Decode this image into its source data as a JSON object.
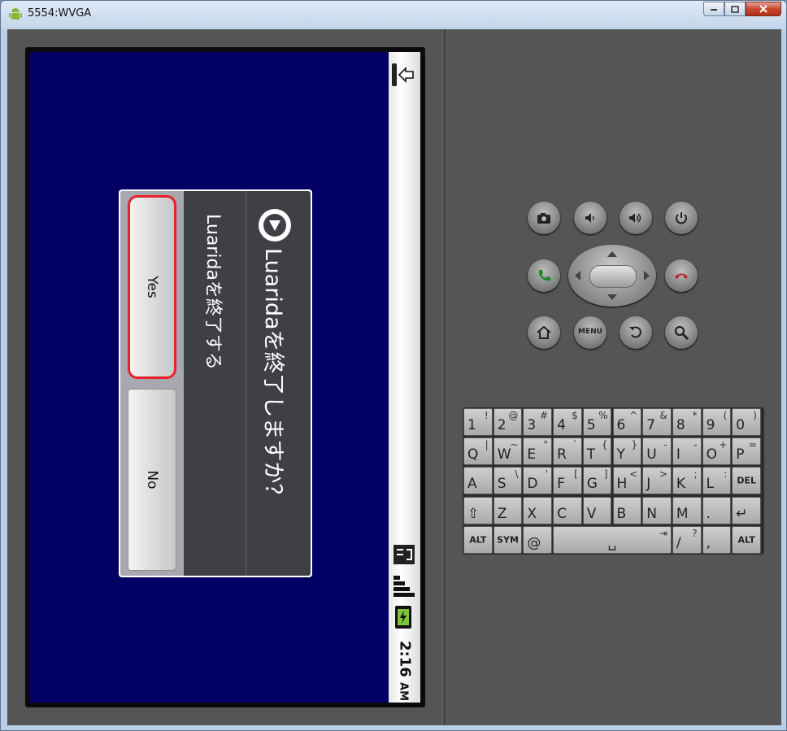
{
  "window": {
    "title": "5554:WVGA"
  },
  "status_bar": {
    "network": "3G",
    "time": "2:16",
    "ampm": "AM"
  },
  "dialog": {
    "title": "Luaridaを終了しますか？",
    "message": "Luaridaを終了する",
    "yes_label": "Yes",
    "no_label": "No"
  },
  "hardware_keys": {
    "menu_label": "MENU"
  },
  "keyboard": {
    "rows": [
      [
        [
          "1",
          "!"
        ],
        [
          "2",
          "@"
        ],
        [
          "3",
          "#"
        ],
        [
          "4",
          "$"
        ],
        [
          "5",
          "%"
        ],
        [
          "6",
          "^"
        ],
        [
          "7",
          "&"
        ],
        [
          "8",
          "*"
        ],
        [
          "9",
          "("
        ],
        [
          "0",
          ")"
        ]
      ],
      [
        [
          "Q",
          "|"
        ],
        [
          "W",
          "~"
        ],
        [
          "E",
          "\""
        ],
        [
          "R",
          "`"
        ],
        [
          "T",
          "{"
        ],
        [
          "Y",
          "}"
        ],
        [
          "U",
          "-"
        ],
        [
          "I",
          "-"
        ],
        [
          "O",
          "+"
        ],
        [
          "P",
          "="
        ]
      ],
      [
        [
          "A",
          ""
        ],
        [
          "S",
          "\\"
        ],
        [
          "D",
          "'"
        ],
        [
          "F",
          "["
        ],
        [
          "G",
          "]"
        ],
        [
          "H",
          "<"
        ],
        [
          "J",
          ">"
        ],
        [
          "K",
          ";"
        ],
        [
          "L",
          ":"
        ],
        [
          "DEL",
          ""
        ]
      ],
      [
        [
          "⇧",
          ""
        ],
        [
          "Z",
          ""
        ],
        [
          "X",
          ""
        ],
        [
          "C",
          ""
        ],
        [
          "V",
          ""
        ],
        [
          "B",
          ""
        ],
        [
          "N",
          ""
        ],
        [
          "M",
          ""
        ],
        [
          ".",
          ""
        ],
        [
          "↵",
          ""
        ]
      ]
    ],
    "bottom_row": {
      "alt_left": "ALT",
      "sym": "SYM",
      "at": "@",
      "space": "␣",
      "tab": "⇥",
      "slash": "/",
      "question": "?",
      "comma": ",",
      "alt_right": "ALT"
    }
  },
  "colors": {
    "screen_bg": "#020064",
    "dialog_bg": "#3f3f46",
    "yes_highlight": "#e8202a"
  }
}
